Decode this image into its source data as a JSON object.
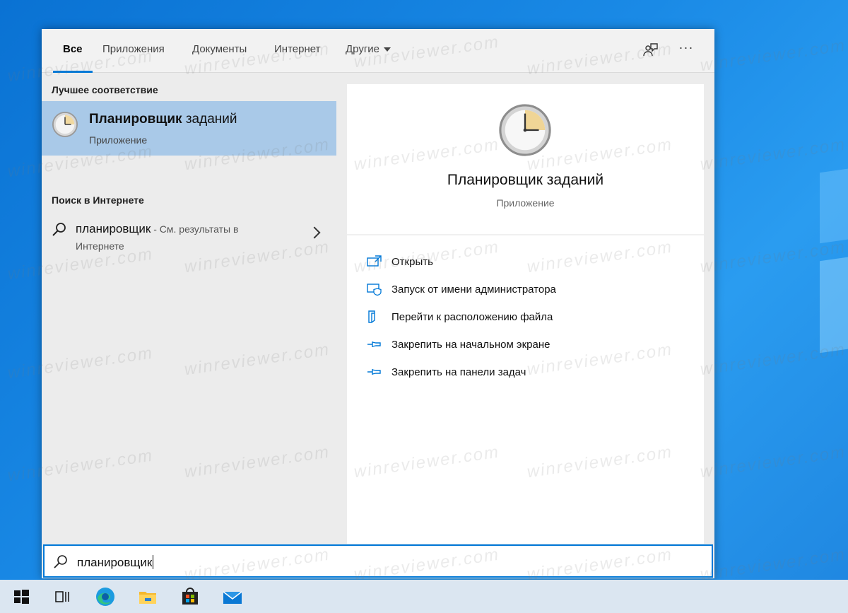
{
  "tabs": [
    {
      "label": "Все"
    },
    {
      "label": "Приложения"
    },
    {
      "label": "Документы"
    },
    {
      "label": "Интернет"
    },
    {
      "label": "Другие"
    }
  ],
  "toolbar": {
    "more_label": "···"
  },
  "left": {
    "best_match_header": "Лучшее соответствие",
    "best_match": {
      "title_bold": "Планировщик",
      "title_rest": " заданий",
      "subtitle": "Приложение"
    },
    "web_header": "Поиск в Интернете",
    "web_result": {
      "query": "планировщик",
      "hint": " - См. результаты в",
      "hint_line2": "Интернете"
    }
  },
  "preview": {
    "title": "Планировщик заданий",
    "subtitle": "Приложение",
    "actions": [
      {
        "label": "Открыть",
        "icon": "open-icon"
      },
      {
        "label": "Запуск от имени администратора",
        "icon": "shield-icon"
      },
      {
        "label": "Перейти к расположению файла",
        "icon": "file-location-icon"
      },
      {
        "label": "Закрепить на начальном экране",
        "icon": "pin-icon"
      },
      {
        "label": "Закрепить на панели задач",
        "icon": "pin-icon"
      }
    ]
  },
  "search": {
    "value": "планировщик"
  },
  "taskbar": {
    "items": [
      "start-icon",
      "task-view-icon",
      "edge-icon",
      "file-explorer-icon",
      "store-icon",
      "mail-icon"
    ]
  },
  "watermark": "winreviewer.com",
  "colors": {
    "accent": "#0078d7",
    "selected_bg": "#a9c9e8",
    "taskbar_bg": "#dbe6f1"
  }
}
